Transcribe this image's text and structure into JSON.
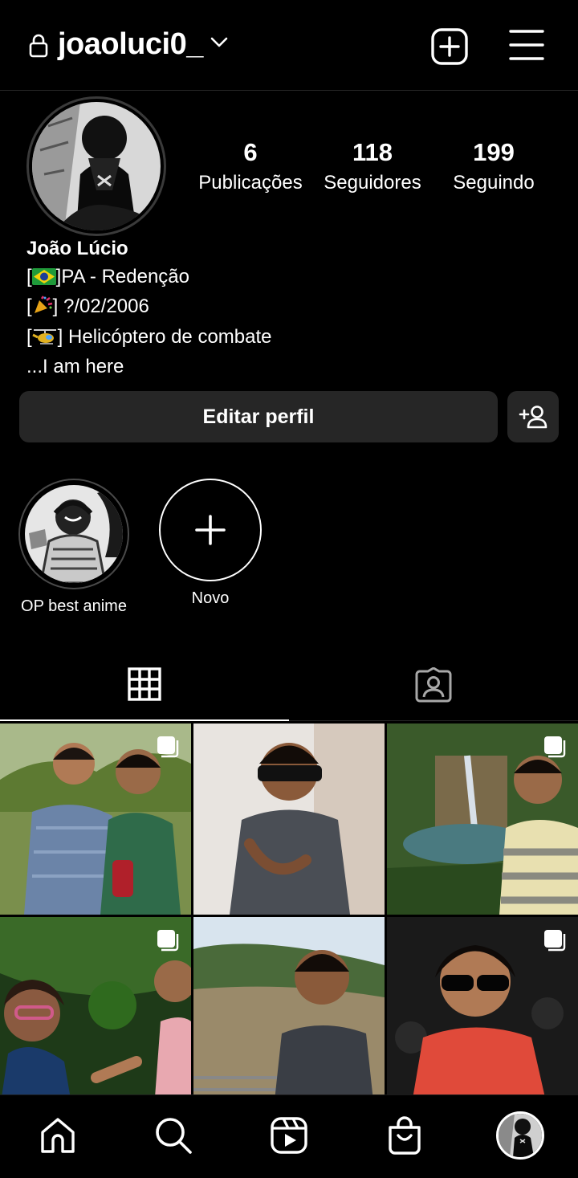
{
  "header": {
    "username": "joaoluci0_"
  },
  "profile": {
    "stats": [
      {
        "value": "6",
        "label": "Publicações"
      },
      {
        "value": "118",
        "label": "Seguidores"
      },
      {
        "value": "199",
        "label": "Seguindo"
      }
    ],
    "name": "João Lúcio",
    "bio_line1": "PA - Redenção",
    "bio_line2": "?/02/2006",
    "bio_line3": "Helicóptero de combate",
    "bio_line4": "...I am here",
    "edit_label": "Editar perfil"
  },
  "highlights": [
    {
      "label": "OP best anime"
    },
    {
      "label": "Novo"
    }
  ],
  "tabs": [
    {
      "icon": "grid-icon"
    },
    {
      "icon": "tagged-icon"
    }
  ],
  "nav": [
    {
      "icon": "home-icon"
    },
    {
      "icon": "search-icon"
    },
    {
      "icon": "reels-icon"
    },
    {
      "icon": "shop-icon"
    },
    {
      "icon": "profile-avatar"
    }
  ]
}
